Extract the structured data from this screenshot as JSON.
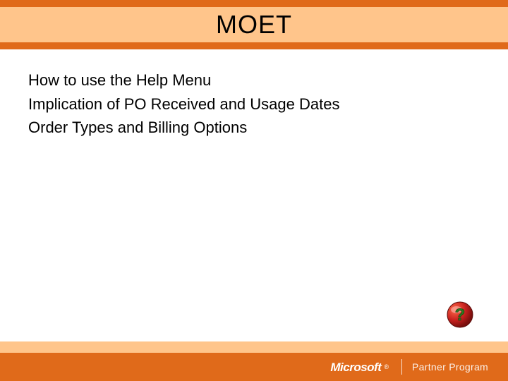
{
  "title": "MOET",
  "content_lines": [
    "How to use the Help Menu",
    "Implication of PO Received and Usage Dates",
    "Order Types and Billing Options"
  ],
  "footer": {
    "brand": "Microsoft",
    "registered": "®",
    "program": "Partner Program"
  },
  "help_icon_name": "help-question-icon",
  "colors": {
    "orange_dark": "#e06a1a",
    "orange_light": "#ffc58b",
    "help_red": "#c6201e",
    "help_green": "#2a7a1f"
  }
}
